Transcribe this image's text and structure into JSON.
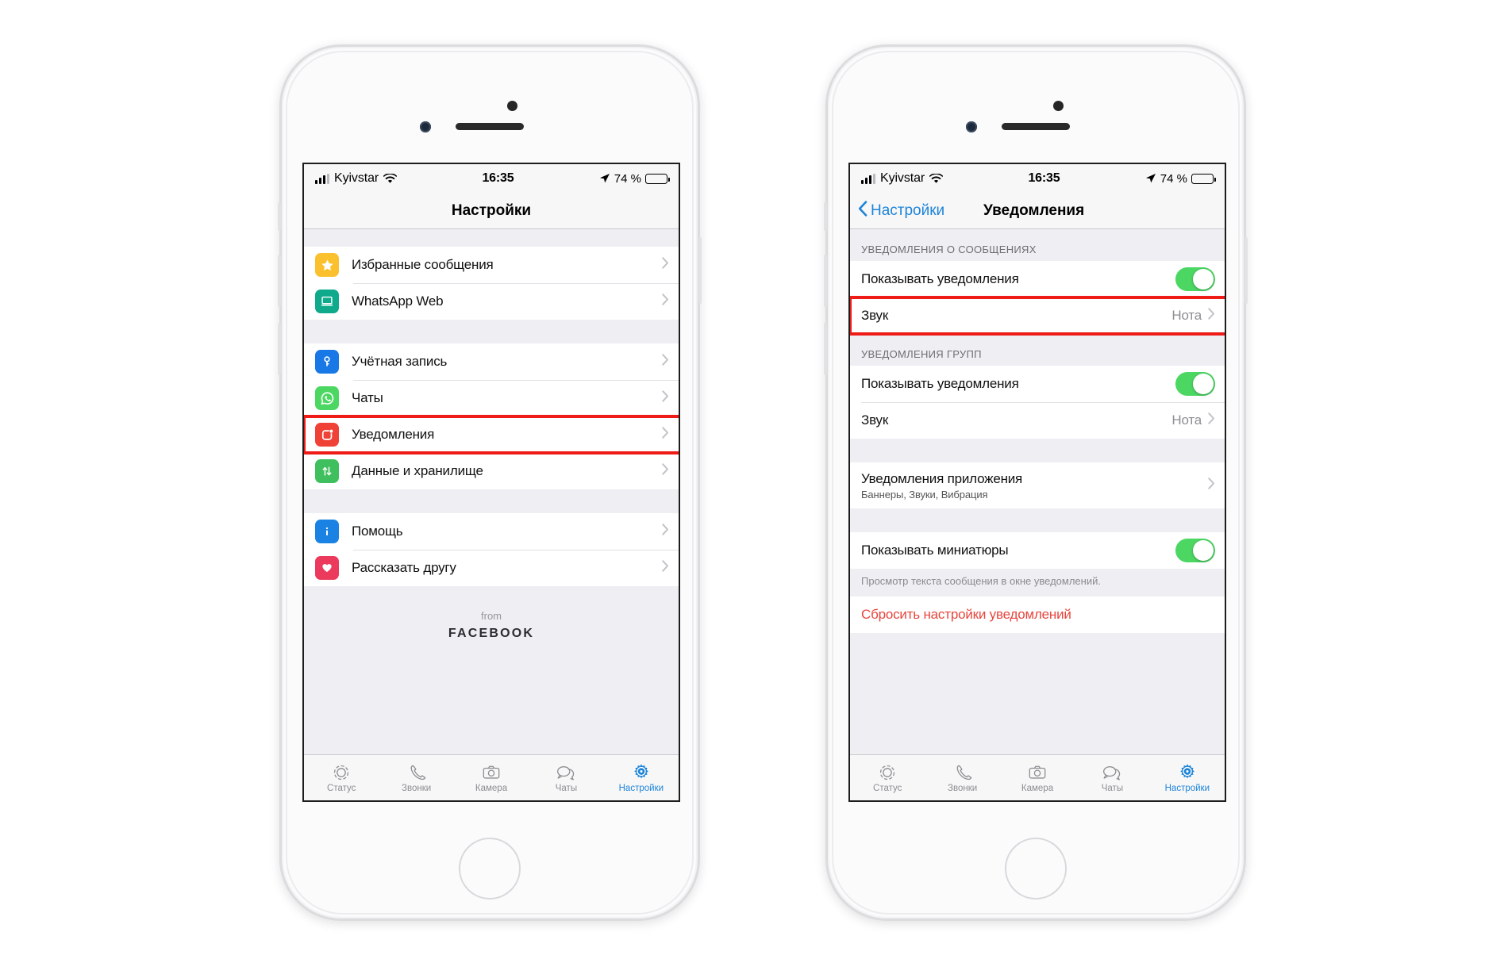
{
  "statusbar": {
    "carrier": "Kyivstar",
    "time": "16:35",
    "battery_pct": "74 %",
    "signal_icon": "cellular-bars-icon",
    "wifi_icon": "wifi-icon",
    "location_icon": "location-arrow-icon",
    "battery_icon": "battery-icon"
  },
  "colors": {
    "highlight_red": "#ee1b17",
    "ios_blue": "#1e84d8",
    "toggle_green": "#4cd763",
    "destructive_red": "#e8453c",
    "group_bg": "#eeeef3"
  },
  "phone_left": {
    "nav": {
      "title": "Настройки"
    },
    "sections": [
      {
        "rows": [
          {
            "label": "Избранные сообщения",
            "icon": "star-icon",
            "icon_color": "#fbc02d",
            "accessory": "chevron"
          },
          {
            "label": "WhatsApp Web",
            "icon": "laptop-icon",
            "icon_color": "#0eaa8b",
            "accessory": "chevron"
          }
        ]
      },
      {
        "rows": [
          {
            "label": "Учётная запись",
            "icon": "key-icon",
            "icon_color": "#1878e6",
            "accessory": "chevron"
          },
          {
            "label": "Чаты",
            "icon": "whatsapp-icon",
            "icon_color": "#4cd763",
            "accessory": "chevron"
          },
          {
            "label": "Уведомления",
            "icon": "notification-bell-icon",
            "icon_color": "#ef4136",
            "accessory": "chevron",
            "highlighted": true
          },
          {
            "label": "Данные и хранилище",
            "icon": "data-arrows-icon",
            "icon_color": "#3fbf5d",
            "accessory": "chevron"
          }
        ]
      },
      {
        "rows": [
          {
            "label": "Помощь",
            "icon": "info-icon",
            "icon_color": "#1a82e2",
            "accessory": "chevron"
          },
          {
            "label": "Рассказать другу",
            "icon": "heart-icon",
            "icon_color": "#ec3a5c",
            "accessory": "chevron"
          }
        ]
      }
    ],
    "brand": {
      "from": "from",
      "name": "FACEBOOK"
    }
  },
  "phone_right": {
    "nav": {
      "back_label": "Настройки",
      "title": "Уведомления",
      "back_icon": "chevron-left-icon"
    },
    "section_messages": {
      "header": "УВЕДОМЛЕНИЯ О СООБЩЕНИЯХ",
      "rows": [
        {
          "label": "Показывать уведомления",
          "control": "toggle",
          "toggle_on": true
        },
        {
          "label": "Звук",
          "value": "Нота",
          "accessory": "chevron",
          "highlighted": true
        }
      ]
    },
    "section_groups": {
      "header": "УВЕДОМЛЕНИЯ ГРУПП",
      "rows": [
        {
          "label": "Показывать уведомления",
          "control": "toggle",
          "toggle_on": true
        },
        {
          "label": "Звук",
          "value": "Нота",
          "accessory": "chevron"
        }
      ]
    },
    "section_app": {
      "rows": [
        {
          "label": "Уведомления приложения",
          "sublabel": "Баннеры, Звуки, Вибрация",
          "accessory": "chevron"
        }
      ]
    },
    "section_previews": {
      "rows": [
        {
          "label": "Показывать миниатюры",
          "control": "toggle",
          "toggle_on": true
        }
      ],
      "footer": "Просмотр текста сообщения в окне уведомлений."
    },
    "section_reset": {
      "rows": [
        {
          "label": "Сбросить настройки уведомлений",
          "destructive": true
        }
      ]
    }
  },
  "tabbar": {
    "tabs": [
      {
        "label": "Статус",
        "icon": "status-ring-icon",
        "active": false
      },
      {
        "label": "Звонки",
        "icon": "phone-handset-icon",
        "active": false
      },
      {
        "label": "Камера",
        "icon": "camera-icon",
        "active": false
      },
      {
        "label": "Чаты",
        "icon": "chat-bubbles-icon",
        "active": false
      },
      {
        "label": "Настройки",
        "icon": "gear-icon",
        "active": true
      }
    ]
  }
}
